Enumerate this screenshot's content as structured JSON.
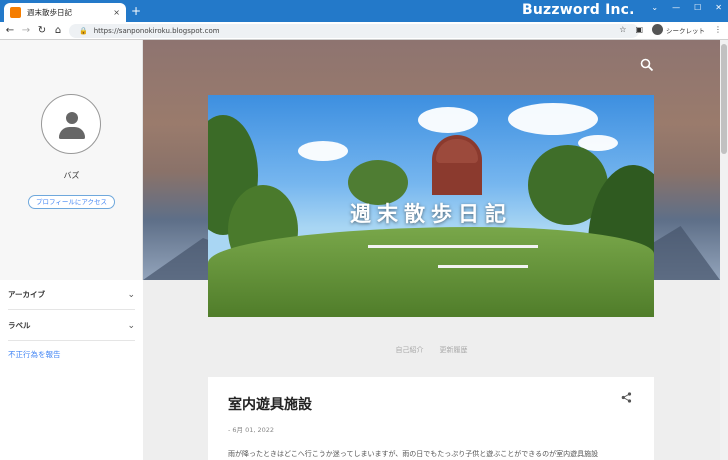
{
  "browser": {
    "tab_title": "週末散歩日記",
    "tab_close": "×",
    "new_tab": "+",
    "brand": "Buzzword Inc.",
    "url": "https://sanponokiroku.blogspot.com",
    "incognito_label": "シークレット",
    "accent_color": "#2379c9"
  },
  "sidebar": {
    "username": "バズ",
    "profile_button": "プロフィールにアクセス",
    "items": [
      {
        "label": "アーカイブ",
        "icon": "chevron-down-icon"
      },
      {
        "label": "ラベル",
        "icon": "chevron-down-icon"
      }
    ],
    "report_link": "不正行為を報告"
  },
  "header": {
    "blog_title": "週末散歩日記",
    "icon": "search-icon"
  },
  "nav": {
    "links": [
      "自己紹介",
      "更新履歴"
    ]
  },
  "post": {
    "title": "室内遊具施設",
    "date": "- 6月 01, 2022",
    "excerpt": "雨が降ったときはどこへ行こうか迷ってしまいますが、雨の日でもたっぷり子供と遊ぶことができるのが室内遊具施設",
    "icon": "share-icon"
  }
}
